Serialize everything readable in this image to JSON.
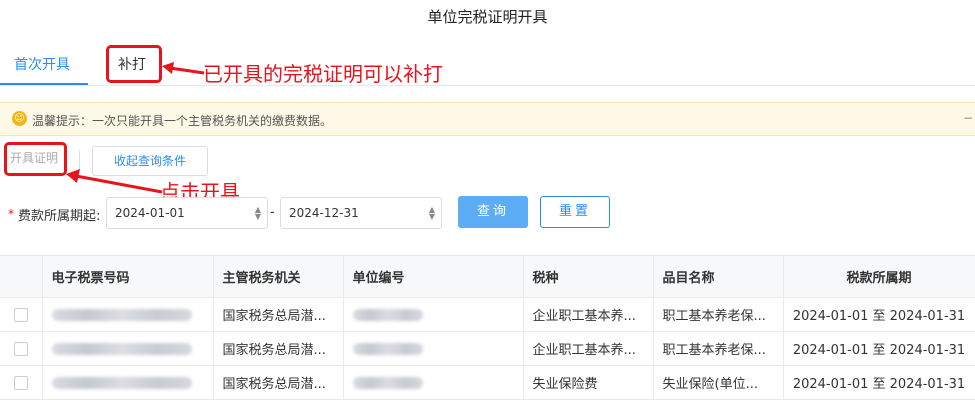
{
  "page_title": "单位完税证明开具",
  "tabs": [
    {
      "label": "首次开具",
      "active": true
    },
    {
      "label": "补打",
      "active": false
    }
  ],
  "annotations": {
    "reprint_note": "已开具的完税证明可以补打",
    "click_note": "点击开具",
    "color": "#e8141b"
  },
  "tip": {
    "icon": "smile-icon",
    "text": "温馨提示：一次只能开具一个主管税务机关的缴费数据。"
  },
  "actions": {
    "issue_label": "开具证明",
    "collapse_label": "收起查询条件"
  },
  "filter": {
    "label": "费款所属期起:",
    "start_date": "2024-01-01",
    "separator": "-",
    "end_date": "2024-12-31",
    "query_label": "查询",
    "reset_label": "重置"
  },
  "table": {
    "columns": [
      "电子税票号码",
      "主管税务机关",
      "单位编号",
      "税种",
      "品目名称",
      "税款所属期"
    ],
    "rows": [
      {
        "org": "国家税务总局潜...",
        "tax_type": "企业职工基本养...",
        "item": "职工基本养老保...",
        "period": "2024-01-01 至 2024-01-31"
      },
      {
        "org": "国家税务总局潜...",
        "tax_type": "企业职工基本养...",
        "item": "职工基本养老保...",
        "period": "2024-01-01 至 2024-01-31"
      },
      {
        "org": "国家税务总局潜...",
        "tax_type": "失业保险费",
        "item": "失业保险(单位...",
        "period": "2024-01-01 至 2024-01-31"
      }
    ]
  },
  "colors": {
    "accent": "#2d8cf0",
    "query_button": "#5cadf5",
    "tip_background": "#fef9e6"
  }
}
